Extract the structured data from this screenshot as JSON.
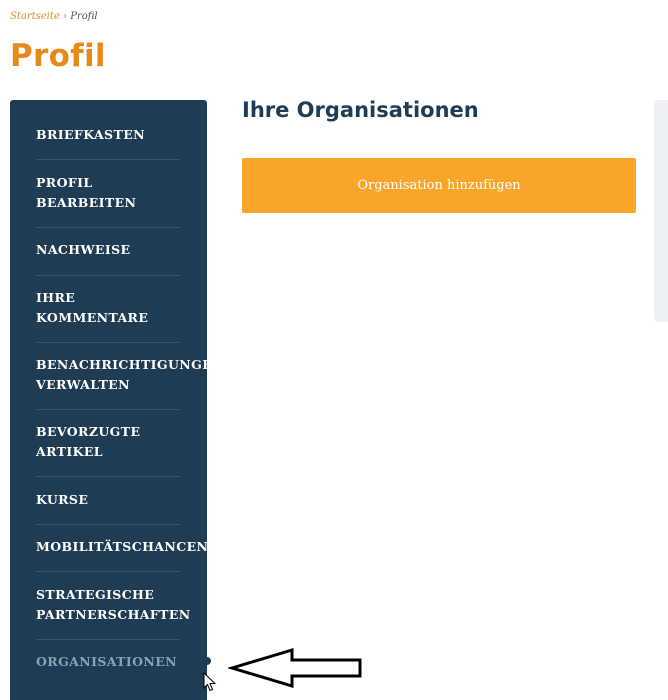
{
  "breadcrumb": {
    "home": "Startseite",
    "separator": "›",
    "current": "Profil"
  },
  "page": {
    "title": "Profil"
  },
  "sidebar": {
    "items": [
      {
        "label": "BRIEFKASTEN"
      },
      {
        "label_lines": [
          "PROFIL",
          "BEARBEITEN"
        ]
      },
      {
        "label": "NACHWEISE"
      },
      {
        "label_lines": [
          "IHRE",
          "KOMMENTARE"
        ]
      },
      {
        "label_lines": [
          "BENACHRICHTIGUNGEN",
          "VERWALTEN"
        ]
      },
      {
        "label_lines": [
          "BEVORZUGTE",
          "ARTIKEL"
        ]
      },
      {
        "label": "KURSE"
      },
      {
        "label": "MOBILITÄTSCHANCEN"
      },
      {
        "label_lines": [
          "STRATEGISCHE",
          "PARTNERSCHAFTEN"
        ]
      },
      {
        "label": "ORGANISATIONEN",
        "active": true
      }
    ]
  },
  "main": {
    "section_title": "Ihre Organisationen",
    "add_button_label": "Organisation hinzufügen"
  },
  "colors": {
    "accent_orange": "#e8891c",
    "button_orange": "#f9a52a",
    "sidebar_bg": "#1e3d54",
    "heading_navy": "#1e3d54",
    "active_item": "#8fa1ae"
  },
  "icons": {
    "annotation": "left-arrow-icon",
    "pointer": "mouse-cursor-icon"
  }
}
